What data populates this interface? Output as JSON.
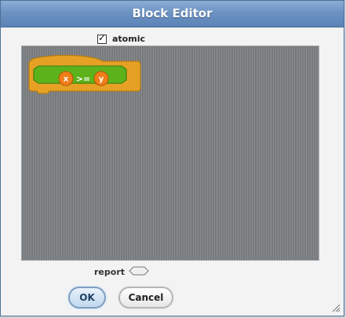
{
  "window": {
    "title": "Block Editor"
  },
  "options": {
    "atomic_label": "atomic",
    "atomic_checked": true,
    "check_glyph": "✓"
  },
  "block": {
    "left_input": "x",
    "operator": ">=",
    "right_input": "y",
    "colors": {
      "hat": "#e6a125",
      "predicate": "#5cb21a",
      "variable": "#ef7e1a"
    }
  },
  "footer": {
    "report_label": "report",
    "ok_label": "OK",
    "cancel_label": "Cancel"
  },
  "icons": {
    "resize": "resize-grip-icon"
  }
}
